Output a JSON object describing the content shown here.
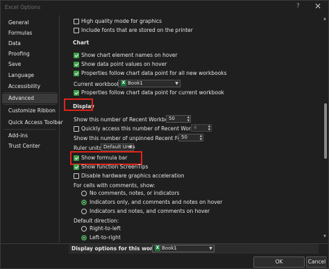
{
  "window": {
    "title": "Excel Options",
    "help": "?",
    "close": "✕"
  },
  "sidebar": {
    "items": [
      {
        "label": "General"
      },
      {
        "label": "Formulas"
      },
      {
        "label": "Data"
      },
      {
        "label": "Proofing"
      },
      {
        "label": "Save"
      },
      {
        "label": "Language"
      },
      {
        "label": "Accessibility"
      },
      {
        "label": "Advanced",
        "selected": true
      },
      {
        "label": "Customize Ribbon"
      },
      {
        "label": "Quick Access Toolbar"
      },
      {
        "label": "Add-ins"
      },
      {
        "label": "Trust Center"
      }
    ]
  },
  "top_options": [
    {
      "label": "High quality mode for graphics",
      "checked": false
    },
    {
      "label": "Include fonts that are stored on the printer",
      "checked": false
    }
  ],
  "chart": {
    "heading": "Chart",
    "opt1": {
      "label": "Show chart element names on hover",
      "checked": true
    },
    "opt2": {
      "label": "Show data point values on hover",
      "checked": true
    },
    "opt3": {
      "label": "Properties follow chart data point for all new workbooks",
      "checked": true
    },
    "current_workbook_label": "Current workbook:",
    "current_workbook_value": "Book1",
    "opt4": {
      "label": "Properties follow chart data point for current workbook",
      "checked": true
    }
  },
  "display": {
    "heading": "Display",
    "recent_workbooks_label": "Show this number of Recent Workbooks:",
    "recent_workbooks_value": "50",
    "quick_access_label": "Quickly access this number of Recent Workbooks:",
    "quick_access_value": "4",
    "quick_access_checked": false,
    "unpinned_folders_label": "Show this number of unpinned Recent Folders:",
    "unpinned_folders_value": "50",
    "ruler_units_label": "Ruler units",
    "ruler_units_value": "Default Units",
    "formula_bar": {
      "label": "Show formula bar",
      "checked": true
    },
    "screentips": {
      "label": "Show function ScreenTips",
      "checked": true
    },
    "hw_accel": {
      "label": "Disable hardware graphics acceleration",
      "checked": false
    },
    "comments_label": "For cells with comments, show:",
    "comments_options": [
      {
        "label": "No comments, notes, or indicators",
        "selected": false
      },
      {
        "label": "Indicators only, and comments and notes on hover",
        "selected": true
      },
      {
        "label": "Indicators and notes, and comments on hover",
        "selected": false
      }
    ],
    "direction_label": "Default direction:",
    "direction_options": [
      {
        "label": "Right-to-left",
        "selected": false
      },
      {
        "label": "Left-to-right",
        "selected": true
      }
    ]
  },
  "workbook_display": {
    "heading": "Display options for this workbook:",
    "value": "Book1"
  },
  "footer": {
    "ok": "OK",
    "cancel": "Cancel"
  },
  "colors": {
    "accent_green": "#3fa14a",
    "highlight_red": "#e2231a",
    "background": "#1f1f1f"
  }
}
